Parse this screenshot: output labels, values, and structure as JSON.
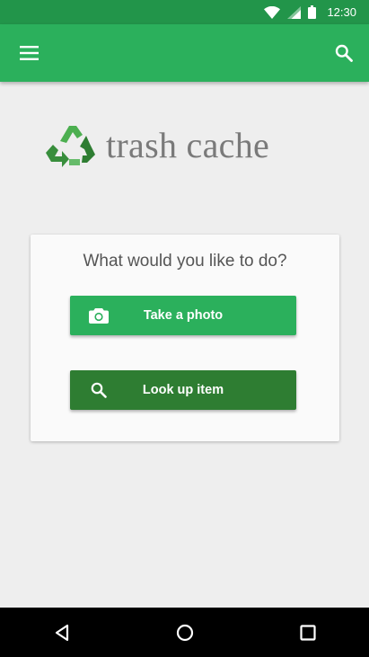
{
  "status_bar": {
    "time": "12:30"
  },
  "app_bar": {
    "menu_icon": "hamburger-menu-icon",
    "search_icon": "search-icon"
  },
  "logo": {
    "text": "trash cache",
    "icon": "recycle-icon"
  },
  "card": {
    "title": "What would you like to do?",
    "buttons": [
      {
        "label": "Take a photo",
        "icon": "camera-icon"
      },
      {
        "label": "Look up item",
        "icon": "search-icon"
      }
    ]
  },
  "nav_bar": {
    "back_icon": "back-triangle-icon",
    "home_icon": "home-circle-icon",
    "recents_icon": "recents-square-icon"
  },
  "colors": {
    "status_bar": "#22954a",
    "app_bar": "#2bb05c",
    "primary_button": "#2bb05c",
    "secondary_button": "#2e7d32",
    "background": "#eeeeee"
  }
}
